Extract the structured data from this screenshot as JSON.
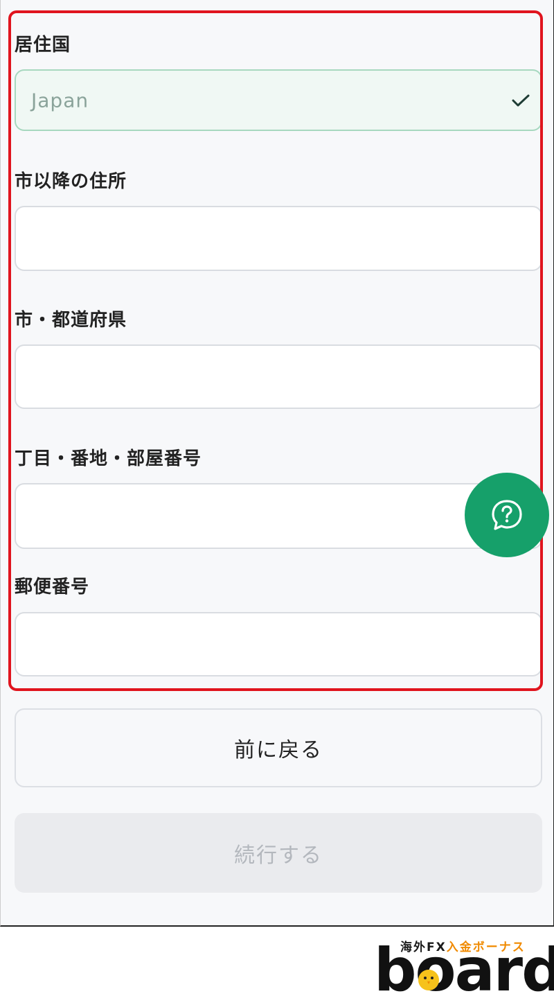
{
  "form": {
    "country": {
      "label": "居住国",
      "value": "Japan"
    },
    "address_after_city": {
      "label": "市以降の住所",
      "value": ""
    },
    "city_prefecture": {
      "label": "市・都道府県",
      "value": ""
    },
    "block_room": {
      "label": "丁目・番地・部屋番号",
      "value": ""
    },
    "postal_code": {
      "label": "郵便番号",
      "value": ""
    }
  },
  "buttons": {
    "back_label": "前に戻る",
    "continue_label": "続行する"
  },
  "colors": {
    "highlight": "#e0141e",
    "help_button": "#16a06a",
    "valid_field_bg": "#f0f8f4"
  },
  "watermark": {
    "tag_part1": "海外FX",
    "tag_part2": "入金ボーナス",
    "word": "board"
  }
}
